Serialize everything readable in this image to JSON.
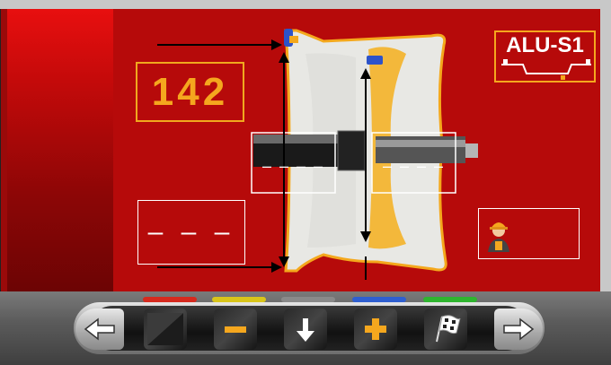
{
  "display": {
    "rim_value": "142",
    "second_value": "– – –",
    "flange_left_value": "– – – –",
    "flange_right_value": "– – – –"
  },
  "program": {
    "label": "ALU-S1"
  },
  "status_leds": [
    {
      "color": "#d62a1e"
    },
    {
      "color": "#d9c51a"
    },
    {
      "color": "#8a8a8a"
    },
    {
      "color": "#2f5fd0"
    },
    {
      "color": "#2fb52f"
    }
  ],
  "toolbar": {
    "buttons": [
      {
        "name": "back-arrow-icon"
      },
      {
        "name": "blank-icon"
      },
      {
        "name": "minus-icon"
      },
      {
        "name": "down-arrow-icon"
      },
      {
        "name": "plus-icon"
      },
      {
        "name": "checkered-flag-icon"
      },
      {
        "name": "forward-arrow-icon"
      }
    ]
  },
  "colors": {
    "accent": "#f5a71e",
    "background": "#b60a0a"
  }
}
